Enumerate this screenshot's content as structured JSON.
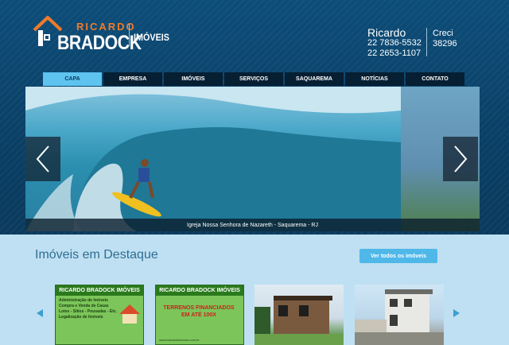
{
  "logo": {
    "ricardo": "RICARDO",
    "bradock": "BRADOCK",
    "imoveis": "IMÓVEIS"
  },
  "contact": {
    "name": "Ricardo",
    "phone1": "22 7836-5532",
    "phone2": "22 2653-1107",
    "creci_label": "Creci",
    "creci_number": "38296"
  },
  "nav": {
    "items": [
      "CAPA",
      "EMPRESA",
      "IMÓVEIS",
      "SERVIÇOS",
      "SAQUAREMA",
      "NOTÍCIAS",
      "CONTATO"
    ],
    "active": "CAPA"
  },
  "slider": {
    "caption": "Igreja Nossa Senhora de Nazareth - Saquarema - RJ",
    "prev_icon": "chevron-left-icon",
    "next_icon": "chevron-right-icon"
  },
  "featured": {
    "title": "Imóveis em Destaque",
    "see_all": "Ver todos os imóveis",
    "cards": [
      {
        "header": "RICARDO BRADOCK IMÓVEIS",
        "lines": [
          "Administração de Imóveis",
          "Compra e Venda de Casas",
          "Lotes - Sítios - Pousadas - Etc.",
          "Legalização de Imóveis"
        ]
      },
      {
        "header": "RICARDO BRADOCK IMÓVEIS",
        "headline": "TERRENOS FINANCIADOS EM ATÉ 100X",
        "url": "www.bradockimoveis.com.br"
      }
    ]
  },
  "colors": {
    "header_bg": "#0c4d79",
    "nav_active": "#5ec3ef",
    "accent_orange": "#f07a2a",
    "button_blue": "#4fb8e8",
    "content_bg": "#bfe0f2"
  }
}
